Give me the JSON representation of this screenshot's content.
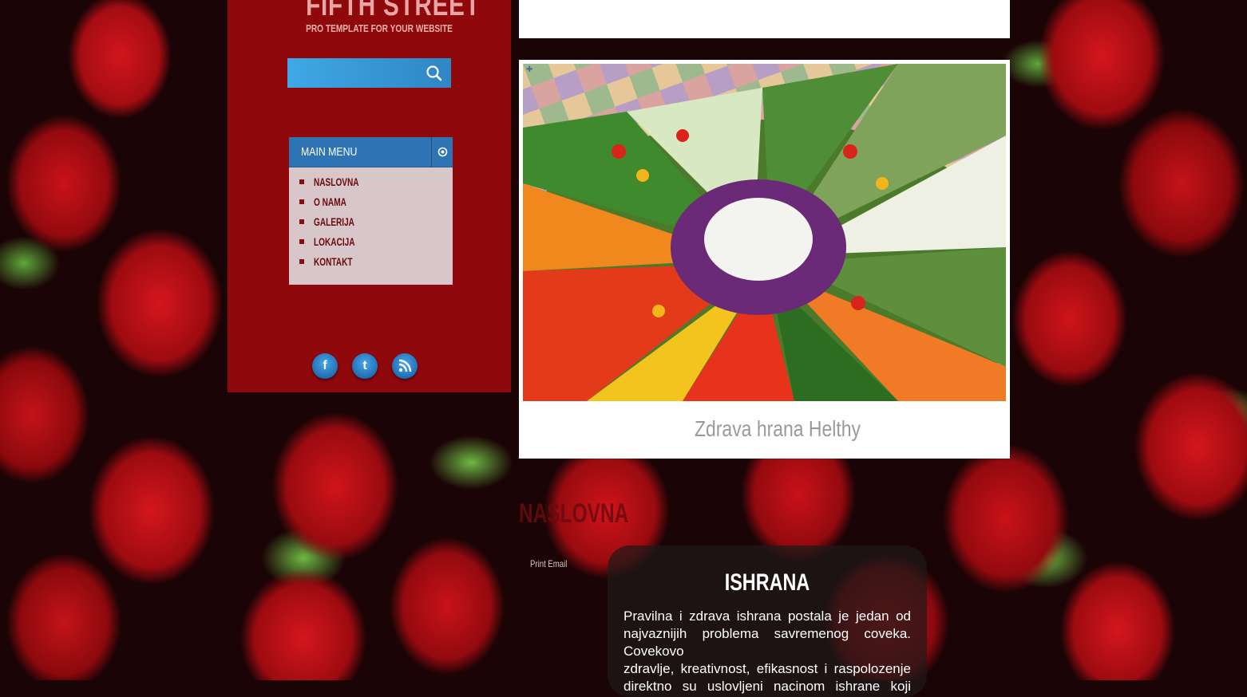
{
  "site": {
    "logo_title": "FIFTH STREET",
    "logo_subtitle": "PRO TEMPLATE FOR YOUR WEBSITE"
  },
  "search": {
    "placeholder": "",
    "icon": "search-icon"
  },
  "main_menu": {
    "title": "MAIN MENU",
    "items": [
      {
        "label": "NASLOVNA"
      },
      {
        "label": "O NAMA"
      },
      {
        "label": "GALERIJA"
      },
      {
        "label": "LOKACIJA"
      },
      {
        "label": "KONTAKT"
      }
    ]
  },
  "social": {
    "facebook": "f",
    "twitter": "t",
    "rss": "rss-icon"
  },
  "slideshow": {
    "caption": "Zdrava hrana Helthy"
  },
  "content": {
    "heading": "NASLOVNA",
    "print_email": "Print Email",
    "article": {
      "title": "ISHRANA",
      "lines": [
        "Pravilna i zdrava ishrana postala je jedan od",
        "najvaznijih problema savremenog coveka. Covekovo",
        "zdravlje, kreativnost, efikasnost i raspolozenje",
        "direktno su uslovljeni nacinom ishrane koji"
      ]
    }
  },
  "colors": {
    "panel_red": "#aa0a0f",
    "menu_blue": "#2e74b5",
    "search_blue": "#3fa8e6",
    "caption_gray": "#9a9a9a"
  }
}
